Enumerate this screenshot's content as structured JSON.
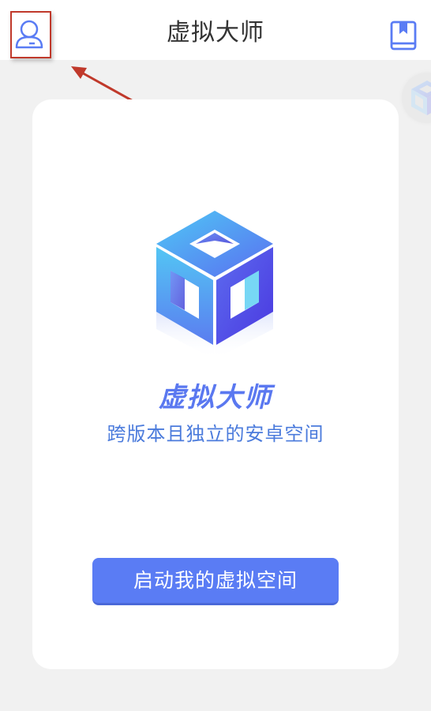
{
  "header": {
    "title": "虚拟大师",
    "profile_icon": "user-icon",
    "book_icon": "bookmark-book-icon"
  },
  "floating": {
    "icon": "cube-icon"
  },
  "annotation": {
    "arrow_color": "#c0392b"
  },
  "card": {
    "logo_icon": "cube-logo-icon",
    "app_name": "虚拟大师",
    "tagline": "跨版本且独立的安卓空间",
    "launch_label": "启动我的虚拟空间"
  },
  "colors": {
    "accent": "#5a7cf4",
    "text_blue": "#4b7bdc",
    "background": "#f1f1f1"
  }
}
